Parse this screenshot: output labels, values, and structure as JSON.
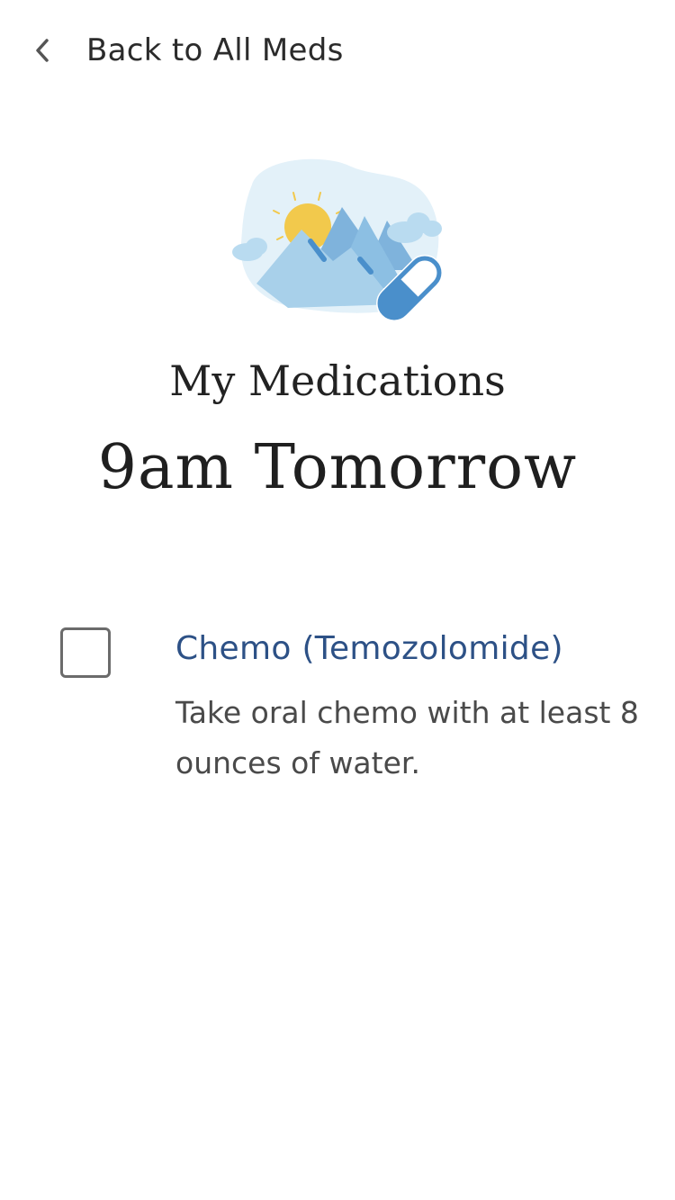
{
  "nav": {
    "back_label": "Back to All Meds",
    "back_icon": "chevron-left-icon"
  },
  "hero": {
    "illustration": "mountains-sun-pill-illustration"
  },
  "page": {
    "heading": "My Medications",
    "time": "9am Tomorrow"
  },
  "medications": [
    {
      "name": "Chemo (Temozolomide)",
      "instructions": "Take oral chemo with at least 8 ounces of water.",
      "checked": false
    }
  ],
  "colors": {
    "accent": "#2d5186",
    "sun": "#f2c94c",
    "sky": "#e3f1f9",
    "mountain_light": "#a8d0ea",
    "mountain_mid": "#7fb3dc",
    "pill_blue": "#4a8fcb"
  }
}
